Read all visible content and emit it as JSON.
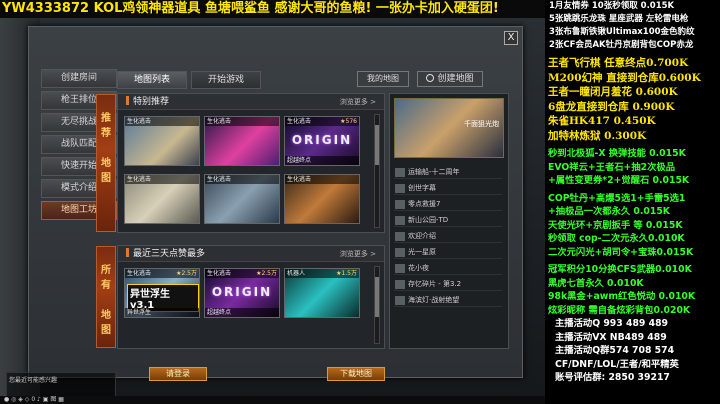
{
  "marquee": "YW4333872 KOL鸡领神器道具 鱼塘喂鲨鱼 感谢大哥的鱼粮! 一张办卡加入硬蛋团!",
  "dialog": {
    "close_label": "X",
    "menu": [
      {
        "label": "创建房间",
        "active": false
      },
      {
        "label": "枪王排位",
        "active": false
      },
      {
        "label": "无尽挑战",
        "active": false
      },
      {
        "label": "战队匹配",
        "active": false
      },
      {
        "label": "快速开始",
        "active": false
      },
      {
        "label": "模式介绍",
        "active": false
      },
      {
        "label": "地图工坊",
        "active": true
      }
    ],
    "tabs": [
      {
        "label": "地图列表",
        "active": true
      },
      {
        "label": "开始游戏",
        "active": false
      }
    ],
    "my_maps_label": "我的地图",
    "create_map_label": "创建地图",
    "section1": {
      "side_label": [
        "推",
        "荐",
        "地",
        "图"
      ],
      "title": "特别推荐",
      "more": "浏览更多 >",
      "cards": [
        {
          "cap": "生化逃击",
          "star": "",
          "name": "",
          "big": ""
        },
        {
          "cap": "生化逃击",
          "star": "",
          "name": "",
          "big": ""
        },
        {
          "cap": "生化逃击",
          "star": "★576",
          "name": "超越终点",
          "big": "ORIGIN"
        },
        {
          "cap": "生化逃击",
          "star": "",
          "name": "",
          "big": ""
        },
        {
          "cap": "生化逃击",
          "star": "",
          "name": "",
          "big": ""
        },
        {
          "cap": "生化逃击",
          "star": "",
          "name": "",
          "big": ""
        }
      ]
    },
    "section2": {
      "side_label": [
        "所",
        "有",
        "地",
        "图"
      ],
      "title": "最近三天点赞最多",
      "more": "浏览更多 >",
      "cards": [
        {
          "cap": "生化逃击",
          "star": "★2.5万",
          "name": "异世浮生",
          "big": "异世浮生 v3.1"
        },
        {
          "cap": "生化逃击",
          "star": "★2.5万",
          "name": "超越终点",
          "big": "ORIGIN"
        },
        {
          "cap": "机器人",
          "star": "★1.5万",
          "name": "",
          "big": ""
        }
      ]
    },
    "list": {
      "preview_title": "千面狙光炮",
      "items": [
        "运输船-十二周年",
        "创世字幕",
        "零点救援7",
        "新山公园-TD",
        "欢迎介绍",
        "光一星原",
        "花小夜",
        "存忆碎片 - 第3.2",
        "海滨灯·战射绝望"
      ]
    },
    "btn_login": "请登录",
    "btn_download": "下载地图"
  },
  "chat": {
    "text": "您最近可能感兴趣"
  },
  "taskbar": {
    "text": "● ◎ ◈ ◇ 0 ♪ ▣ 图 ▦"
  },
  "overlay": {
    "top": [
      "1月友情券  10张秒领取 0.015K",
      "5张跳跳乐龙珠 星座武器 左轮雷电枪",
      "3张布鲁斯铁锹Ultimax100金色豹纹",
      "2张CF会员AK牡丹京剧背包COP赤龙"
    ],
    "prices": [
      "王者飞行棋 任意终点0.700K",
      "M200幻神 直接到仓库0.600K",
      "王者一瞳闭月羞花   0.600K",
      "6盘龙直接到仓库   0.900K",
      "朱雀HK417       0.450K",
      "加特林炼狱       0.300K"
    ],
    "green1": [
      "秒到北极狐-X 换弹技能 0.015K",
      "EVO祥云+王者石+抽2次极品",
      "+属性变更券*2+觉醒石 0.015K"
    ],
    "green2": [
      "COP牡丹+高爆5选1+手雷5选1",
      "+抽极品一次都永久 0.015K",
      "天使光环+京剧扳手 等 0.015K",
      "秒领取 cop-二次元永久0.010K",
      "二次元闪光+胡司令+宝珠0.015K"
    ],
    "green3": [
      "冠军积分10分换CFS武器0.010K",
      "黑虎七首永久 0.010K",
      "98k黑金+awm红色悦动 0.010K",
      "炫彩昵称 需自备炫彩背包0.020K"
    ],
    "contacts": [
      "主播活动Q  993 489 489",
      "主播活动VX  NB489 489",
      "主播活动Q群574 708 574",
      "CF/DNF/LOL/王者/和平精英",
      "账号评估群: 2850 39217"
    ]
  }
}
